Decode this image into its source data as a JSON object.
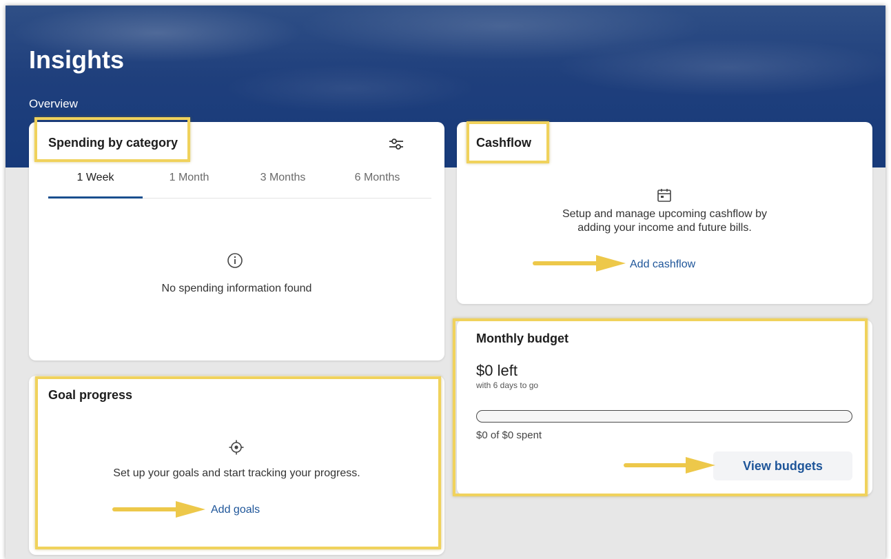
{
  "page": {
    "title": "Insights",
    "section": "Overview"
  },
  "spending": {
    "title": "Spending by category",
    "filter_icon": "sliders-icon",
    "tabs": [
      {
        "label": "1 Week",
        "active": true
      },
      {
        "label": "1 Month",
        "active": false
      },
      {
        "label": "3 Months",
        "active": false
      },
      {
        "label": "6 Months",
        "active": false
      }
    ],
    "empty_icon": "info-icon",
    "empty_text": "No spending information found"
  },
  "cashflow": {
    "title": "Cashflow",
    "icon": "calendar-icon",
    "description_line1": "Setup and manage upcoming cashflow by",
    "description_line2": "adding your income and future bills.",
    "link": "Add cashflow"
  },
  "budget": {
    "title": "Monthly budget",
    "amount_left": "$0 left",
    "days_left": "with 6 days to go",
    "progress": 0,
    "spent": "$0 of $0 spent",
    "button": "View budgets"
  },
  "goals": {
    "title": "Goal progress",
    "icon": "target-icon",
    "description": "Set up your goals and start tracking your progress.",
    "link": "Add goals"
  },
  "colors": {
    "accent": "#1a4f8e",
    "link": "#1e5599",
    "highlight": "#f0d25c",
    "arrow": "#edc84a",
    "header": "#173a7a"
  }
}
